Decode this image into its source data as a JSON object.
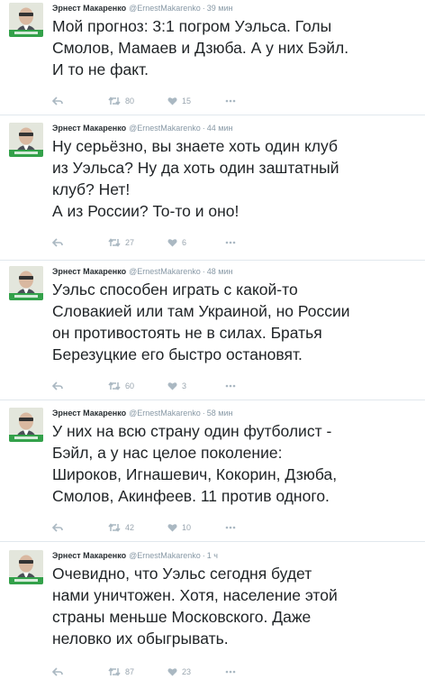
{
  "tweets": [
    {
      "name": "Эрнест Макаренко",
      "handle": "@ErnestMakarenko",
      "time": "39 мин",
      "text": "Мой прогноз: 3:1 погром Уэльса. Голы\nСмолов, Мамаев и Дзюба. А у них Бэйл.\nИ то не факт.",
      "retweets": "80",
      "likes": "15"
    },
    {
      "name": "Эрнест Макаренко",
      "handle": "@ErnestMakarenko",
      "time": "44 мин",
      "text": "Ну серьёзно, вы знаете хоть один клуб\nиз Уэльса? Ну да хоть один заштатный\nклуб? Нет!\nА из России? То-то и оно!",
      "retweets": "27",
      "likes": "6"
    },
    {
      "name": "Эрнест Макаренко",
      "handle": "@ErnestMakarenko",
      "time": "48 мин",
      "text": "Уэльс способен играть с какой-то\nСловакией или там Украиной, но России\nон противостоять не в силах. Братья\nБерезуцкие его быстро остановят.",
      "retweets": "60",
      "likes": "3"
    },
    {
      "name": "Эрнест Макаренко",
      "handle": "@ErnestMakarenko",
      "time": "58 мин",
      "text": "У них на всю страну один футболист -\nБэйл, а у нас целое поколение:\nШироков, Игнашевич, Кокорин, Дзюба,\nСмолов, Акинфеев. 11 против одного.",
      "retweets": "42",
      "likes": "10"
    },
    {
      "name": "Эрнест Макаренко",
      "handle": "@ErnestMakarenko",
      "time": "1 ч",
      "text": "Очевидно, что Уэльс сегодня будет\nнами уничтожен. Хотя, население этой\nстраны меньше Московского. Даже\nнеловко их обыгрывать.",
      "retweets": "87",
      "likes": "23"
    }
  ],
  "icons": {
    "reply": "reply-icon",
    "retweet": "retweet-icon",
    "like": "heart-icon",
    "more": "more-dots-icon"
  },
  "colors": {
    "text": "#1f2326",
    "meta": "#8899a6",
    "icon": "#aab8c2",
    "divider": "#e1e8ed"
  }
}
